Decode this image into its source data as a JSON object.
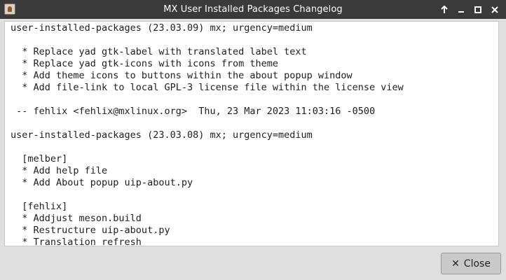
{
  "window": {
    "title": "MX User Installed Packages Changelog",
    "controls": [
      "arrow-up-icon",
      "minimize-icon",
      "maximize-icon",
      "close-icon"
    ]
  },
  "changelog": {
    "lines": [
      "user-installed-packages (23.03.09) mx; urgency=medium",
      "",
      "  * Replace yad gtk-label with translated label text",
      "  * Replace yad gtk-icons with icons from theme",
      "  * Add theme icons to buttons within the about popup window",
      "  * Add file-link to local GPL-3 license file within the license view",
      "",
      " -- fehlix <fehlix@mxlinux.org>  Thu, 23 Mar 2023 11:03:16 -0500",
      "",
      "user-installed-packages (23.03.08) mx; urgency=medium",
      "",
      "  [melber]",
      "  * Add help file",
      "  * Add About popup uip-about.py",
      "",
      "  [fehlix]",
      "  * Addjust meson.build",
      "  * Restructure uip-about.py",
      "  * Translation refresh"
    ]
  },
  "footer": {
    "close_icon": "x-icon",
    "close_glyph": "✕",
    "close_label": "Close"
  }
}
